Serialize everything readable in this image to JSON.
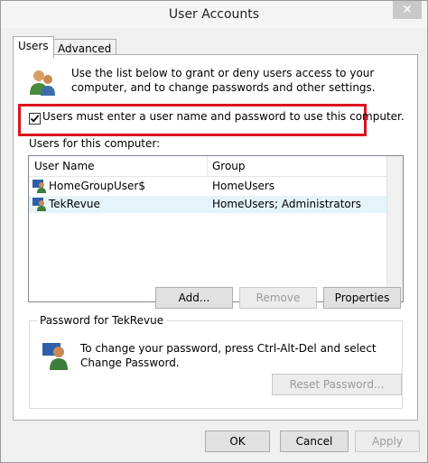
{
  "window": {
    "title": "User Accounts",
    "close_glyph": "✕"
  },
  "tabs": [
    {
      "label": "Users",
      "active": true
    },
    {
      "label": "Advanced",
      "active": false
    }
  ],
  "intro": {
    "icon": "users-icon",
    "text": "Use the list below to grant or deny users access to your computer, and to change passwords and other settings."
  },
  "require_login": {
    "checked": true,
    "label": "Users must enter a user name and password to use this computer.",
    "highlight_color": "#d8141e"
  },
  "users_list": {
    "label": "Users for this computer:",
    "columns": [
      "User Name",
      "Group"
    ],
    "rows": [
      {
        "name": "HomeGroupUser$",
        "group": "HomeUsers",
        "selected": false,
        "icon": "user-icon"
      },
      {
        "name": "TekRevue",
        "group": "HomeUsers; Administrators",
        "selected": true,
        "icon": "user-icon"
      }
    ]
  },
  "list_buttons": {
    "add": "Add...",
    "remove": "Remove",
    "properties": "Properties"
  },
  "password_group": {
    "title": "Password for TekRevue",
    "icon": "user-key-icon",
    "text": "To change your password, press Ctrl-Alt-Del and select Change Password.",
    "reset_button": "Reset Password..."
  },
  "footer_buttons": {
    "ok": "OK",
    "cancel": "Cancel",
    "apply": "Apply"
  }
}
